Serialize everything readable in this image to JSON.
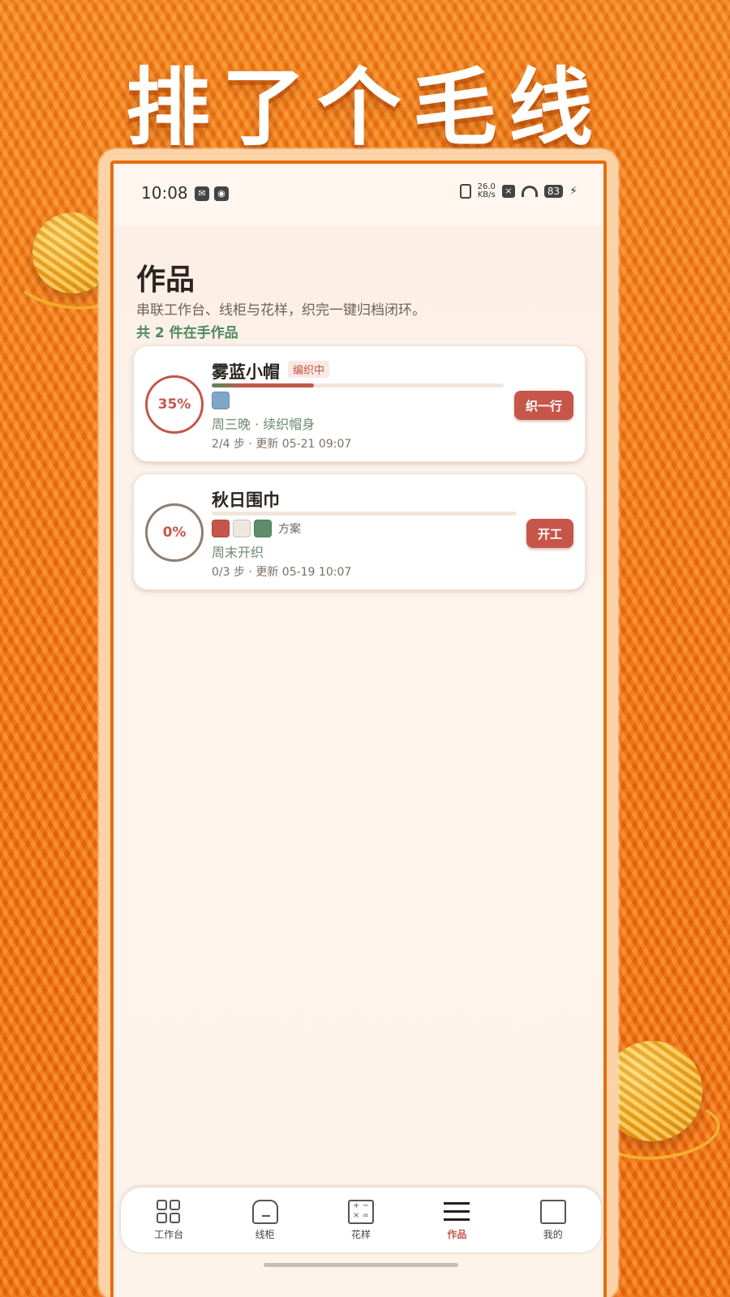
{
  "banner": {
    "title": "排了个毛线"
  },
  "status_bar": {
    "time": "10:08",
    "net_speed_value": "26.0",
    "net_speed_unit": "KB/s",
    "battery": "83"
  },
  "page": {
    "title": "作品",
    "subtitle": "串联工作台、线柜与花样，织完一键归档闭环。",
    "count_text": "共 2 件在手作品"
  },
  "works": [
    {
      "progress_label": "35%",
      "progress": 0.35,
      "name": "雾蓝小帽",
      "badge": "编织中",
      "swatches": [
        "#7ea6c8"
      ],
      "swatch_label": "",
      "note": "周三晚 · 续织帽身",
      "meta": "2/4 步 · 更新 05-21 09:07",
      "action": "织一行"
    },
    {
      "progress_label": "0%",
      "progress": 0,
      "name": "秋日围巾",
      "badge": "",
      "swatches": [
        "#c7564a",
        "#efe6dd",
        "#5f8d6c"
      ],
      "swatch_label": "方案",
      "note": "周末开织",
      "meta": "0/3 步 · 更新 05-19 10:07",
      "action": "开工"
    }
  ],
  "nav": [
    {
      "label": "工作台",
      "icon": "grid-icon",
      "active": false
    },
    {
      "label": "线柜",
      "icon": "home-icon",
      "active": false
    },
    {
      "label": "花样",
      "icon": "calculator-icon",
      "active": false
    },
    {
      "label": "作品",
      "icon": "menu-icon",
      "active": true
    },
    {
      "label": "我的",
      "icon": "profile-card-icon",
      "active": false
    }
  ],
  "colors": {
    "accent": "#c7564a",
    "green": "#4f8a5f",
    "background": "#f57a12"
  }
}
